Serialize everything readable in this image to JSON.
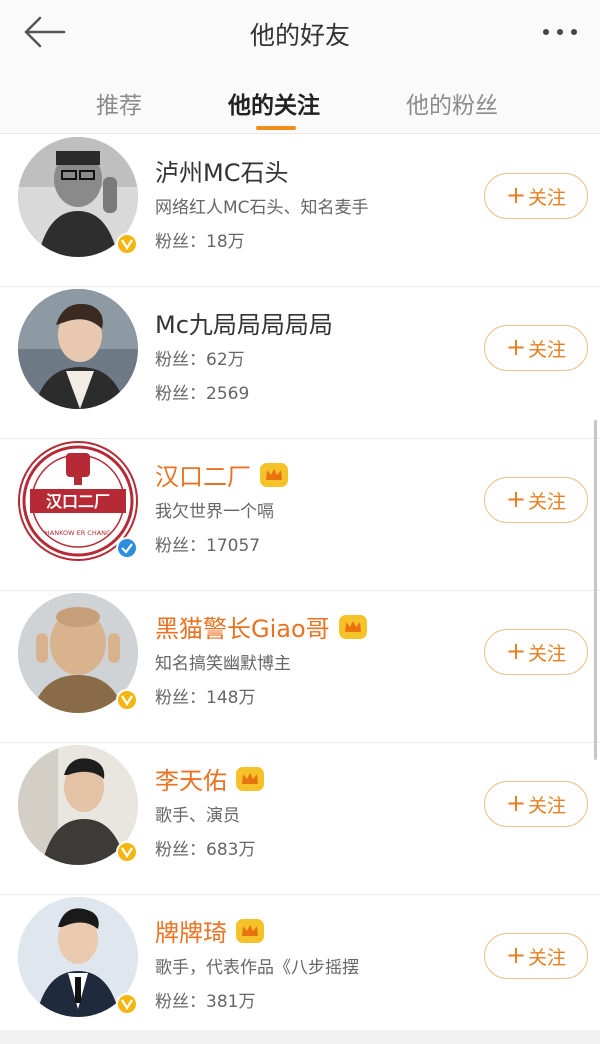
{
  "header": {
    "title": "他的好友",
    "back_icon": "back-arrow-icon",
    "more_icon": "more-dots-icon"
  },
  "tabs": [
    {
      "label": "推荐",
      "active": false
    },
    {
      "label": "他的关注",
      "active": true
    },
    {
      "label": "他的粉丝",
      "active": false
    }
  ],
  "users": [
    {
      "name": "泸州MC石头",
      "line1": "网络红人MC石头、知名麦手",
      "line2": "粉丝：18万",
      "verified": "gold",
      "vip": false,
      "follow_label": "关注"
    },
    {
      "name": "Mc九局局局局局",
      "line1": "粉丝：62万",
      "line2": "粉丝：2569",
      "verified": "none",
      "vip": false,
      "follow_label": "关注"
    },
    {
      "name": "汉口二厂",
      "line1": "我欠世界一个嗝",
      "line2": "粉丝：17057",
      "verified": "blue",
      "vip": true,
      "follow_label": "关注",
      "logo_text": "汉口二厂",
      "logo_sub": "HANKOW ER CHANG"
    },
    {
      "name": "黑猫警长Giao哥",
      "line1": "知名搞笑幽默博主",
      "line2": "粉丝：148万",
      "verified": "gold",
      "vip": true,
      "follow_label": "关注"
    },
    {
      "name": "李天佑",
      "line1": "歌手、演员",
      "line2": "粉丝：683万",
      "verified": "gold",
      "vip": true,
      "follow_label": "关注"
    },
    {
      "name": "牌牌琦",
      "line1": "歌手，代表作品《八步摇摆",
      "line2": "粉丝：381万",
      "verified": "gold",
      "vip": true,
      "follow_label": "关注"
    }
  ],
  "colors": {
    "accent": "#f08c1a",
    "vip_name": "#eb7222",
    "verified_gold": "#f5b50f",
    "verified_blue": "#2c8cde"
  }
}
